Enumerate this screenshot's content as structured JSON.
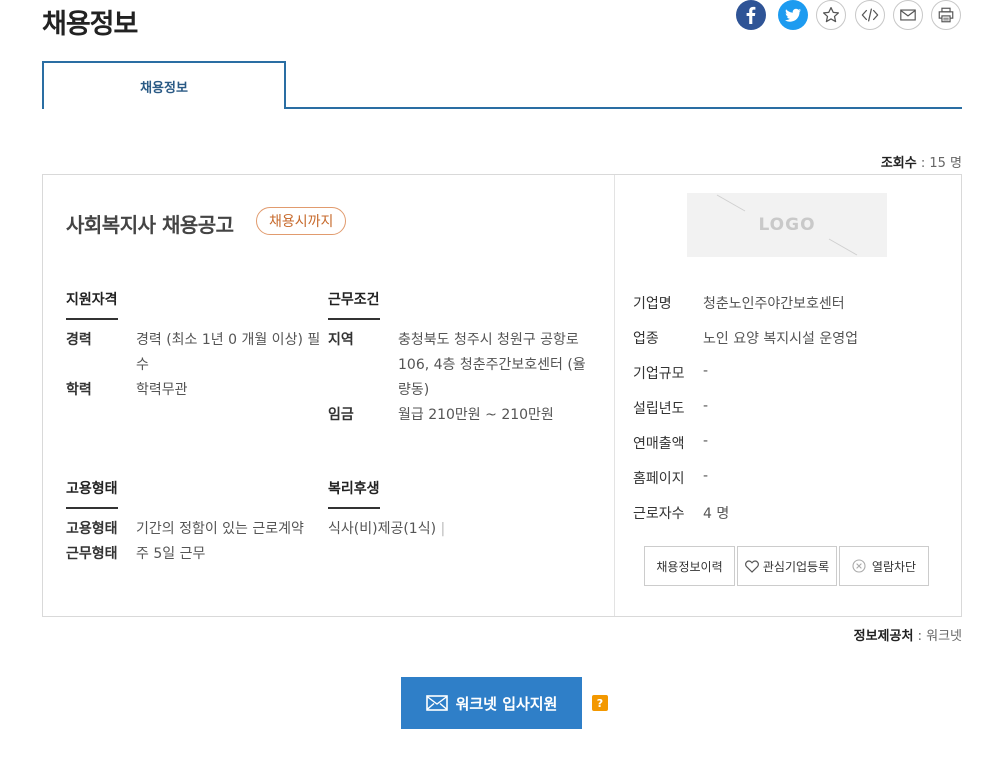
{
  "page": {
    "title": "채용정보"
  },
  "share": {
    "facebook": "facebook-icon",
    "twitter": "twitter-icon",
    "bookmark": "star-icon",
    "embed": "code-icon",
    "email": "mail-icon",
    "print": "printer-icon"
  },
  "tabs": [
    {
      "label": "채용정보"
    }
  ],
  "views": {
    "label": "조회수",
    "value": ": 15 명"
  },
  "job": {
    "title": "사회복지사 채용공고",
    "deadline_badge": "채용시까지",
    "qualification": {
      "heading": "지원자격",
      "career_label": "경력",
      "career_value": "경력 (최소 1년 0 개월 이상) 필수",
      "education_label": "학력",
      "education_value": "학력무관"
    },
    "conditions": {
      "heading": "근무조건",
      "region_label": "지역",
      "region_value": "충청북도 청주시 청원구 공항로 106, 4층 청춘주간보호센터 (율량동)",
      "wage_label": "임금",
      "wage_value": "월급 210만원 ~ 210만원"
    },
    "employment": {
      "heading": "고용형태",
      "type_label": "고용형태",
      "type_value": "기간의 정함이 있는 근로계약",
      "work_label": "근무형태",
      "work_value": "주 5일 근무"
    },
    "welfare": {
      "heading": "복리후생",
      "value": "식사(비)제공(1식)",
      "separator": "|"
    }
  },
  "company": {
    "logo_text": "LOGO",
    "fields": [
      {
        "label": "기업명",
        "value": "청춘노인주야간보호센터"
      },
      {
        "label": "업종",
        "value": "노인 요양 복지시설 운영업"
      },
      {
        "label": "기업규모",
        "value": "-"
      },
      {
        "label": "설립년도",
        "value": "-"
      },
      {
        "label": "연매출액",
        "value": "-"
      },
      {
        "label": "홈페이지",
        "value": "-"
      },
      {
        "label": "근로자수",
        "value": "4 명"
      }
    ],
    "buttons": {
      "history": "채용정보이력",
      "favorite": "관심기업등록",
      "block": "열람차단"
    }
  },
  "provider": {
    "label": "정보제공처",
    "value": ": 워크넷"
  },
  "apply": {
    "label": "워크넷 입사지원",
    "help": "?"
  }
}
